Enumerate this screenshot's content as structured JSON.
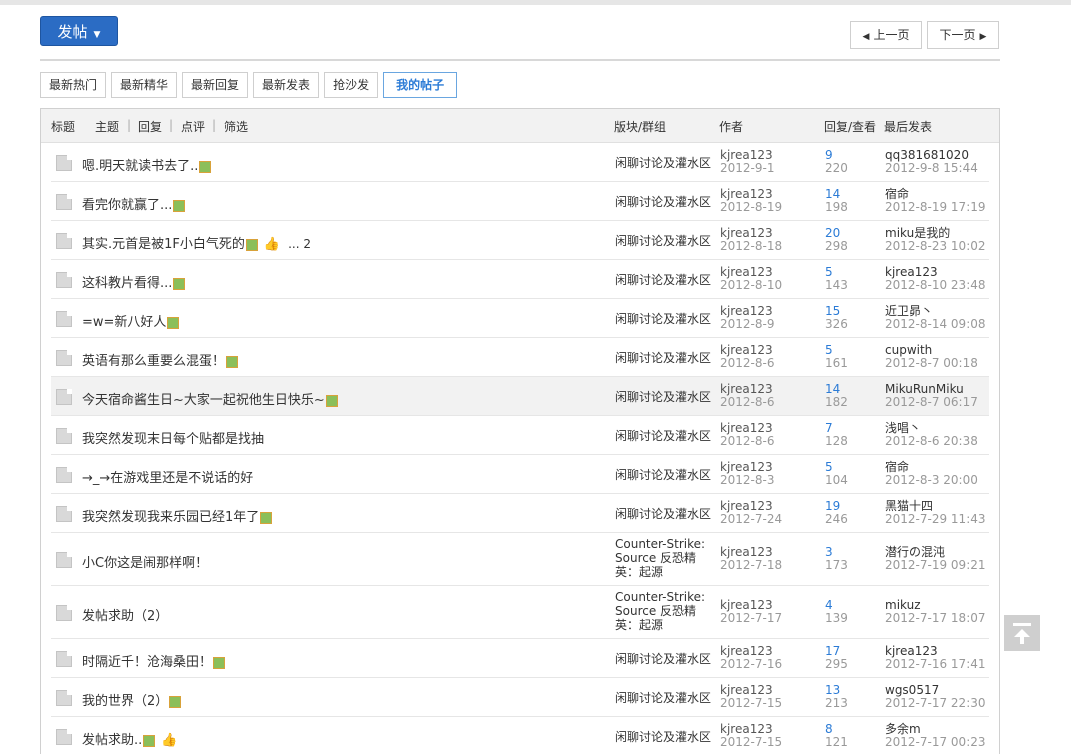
{
  "toolbar": {
    "post_label": "发帖",
    "prev_label": "上一页",
    "next_label": "下一页"
  },
  "tabs": [
    "最新热门",
    "最新精华",
    "最新回复",
    "最新发表",
    "抢沙发",
    "我的帖子"
  ],
  "header": {
    "title": "标题",
    "filters": [
      "主题",
      "回复",
      "点评",
      "筛选"
    ],
    "forum": "版块/群组",
    "author": "作者",
    "counts": "回复/查看",
    "last": "最后发表"
  },
  "rows": [
    {
      "title": "嗯.明天就读书去了..",
      "img": true,
      "forum": "闲聊讨论及灌水区",
      "author": "kjrea123",
      "date": "2012-9-1",
      "replies": "9",
      "views": "220",
      "last_user": "qq381681020",
      "last_time": "2012-9-8 15:44"
    },
    {
      "title": "看完你就赢了...",
      "img": true,
      "forum": "闲聊讨论及灌水区",
      "author": "kjrea123",
      "date": "2012-8-19",
      "replies": "14",
      "views": "198",
      "last_user": "宿命",
      "last_time": "2012-8-19 17:19"
    },
    {
      "title": "其实.元首是被1F小白气死的",
      "img": true,
      "thumb": true,
      "pages": "... 2",
      "forum": "闲聊讨论及灌水区",
      "author": "kjrea123",
      "date": "2012-8-18",
      "replies": "20",
      "views": "298",
      "last_user": "miku是我的",
      "last_time": "2012-8-23 10:02"
    },
    {
      "title": "这科教片看得...",
      "img": true,
      "forum": "闲聊讨论及灌水区",
      "author": "kjrea123",
      "date": "2012-8-10",
      "replies": "5",
      "views": "143",
      "last_user": "kjrea123",
      "last_time": "2012-8-10 23:48"
    },
    {
      "title": "=w=新八好人",
      "img": true,
      "forum": "闲聊讨论及灌水区",
      "author": "kjrea123",
      "date": "2012-8-9",
      "replies": "15",
      "views": "326",
      "last_user": "近卫昴丶",
      "last_time": "2012-8-14 09:08"
    },
    {
      "title": "英语有那么重要么混蛋！",
      "img": true,
      "forum": "闲聊讨论及灌水区",
      "author": "kjrea123",
      "date": "2012-8-6",
      "replies": "5",
      "views": "161",
      "last_user": "cupwith",
      "last_time": "2012-8-7 00:18"
    },
    {
      "title": "今天宿命酱生日~大家一起祝他生日快乐~",
      "img": true,
      "highlight": true,
      "forum": "闲聊讨论及灌水区",
      "author": "kjrea123",
      "date": "2012-8-6",
      "replies": "14",
      "views": "182",
      "last_user": "MikuRunMiku",
      "last_time": "2012-8-7 06:17"
    },
    {
      "title": "我突然发现末日每个贴都是找抽",
      "forum": "闲聊讨论及灌水区",
      "author": "kjrea123",
      "date": "2012-8-6",
      "replies": "7",
      "views": "128",
      "last_user": "浅唱丶",
      "last_time": "2012-8-6 20:38"
    },
    {
      "title": "→_→在游戏里还是不说话的好",
      "forum": "闲聊讨论及灌水区",
      "author": "kjrea123",
      "date": "2012-8-3",
      "replies": "5",
      "views": "104",
      "last_user": "宿命",
      "last_time": "2012-8-3 20:00"
    },
    {
      "title": "我突然发现我来乐园已经1年了",
      "img": true,
      "forum": "闲聊讨论及灌水区",
      "author": "kjrea123",
      "date": "2012-7-24",
      "replies": "19",
      "views": "246",
      "last_user": "黑猫十四",
      "last_time": "2012-7-29 11:43"
    },
    {
      "title": "小C你这是闹那样啊！",
      "forum": "Counter-Strike: Source 反恐精英：起源",
      "tall": true,
      "author": "kjrea123",
      "date": "2012-7-18",
      "replies": "3",
      "views": "173",
      "last_user": "潜行の混沌",
      "last_time": "2012-7-19 09:21"
    },
    {
      "title": "发帖求助（2）",
      "forum": "Counter-Strike: Source 反恐精英：起源",
      "tall": true,
      "author": "kjrea123",
      "date": "2012-7-17",
      "replies": "4",
      "views": "139",
      "last_user": "mikuz",
      "last_time": "2012-7-17 18:07"
    },
    {
      "title": "时隔近千！沧海桑田！",
      "img": true,
      "forum": "闲聊讨论及灌水区",
      "author": "kjrea123",
      "date": "2012-7-16",
      "replies": "17",
      "views": "295",
      "last_user": "kjrea123",
      "last_time": "2012-7-16 17:41"
    },
    {
      "title": "我的世界（2）",
      "img": true,
      "forum": "闲聊讨论及灌水区",
      "author": "kjrea123",
      "date": "2012-7-15",
      "replies": "13",
      "views": "213",
      "last_user": "wgs0517",
      "last_time": "2012-7-17 22:30"
    },
    {
      "title": "发帖求助..",
      "img": true,
      "thumb": true,
      "forum": "闲聊讨论及灌水区",
      "author": "kjrea123",
      "date": "2012-7-15",
      "replies": "8",
      "views": "121",
      "last_user": "多余m",
      "last_time": "2012-7-17 00:23"
    }
  ]
}
